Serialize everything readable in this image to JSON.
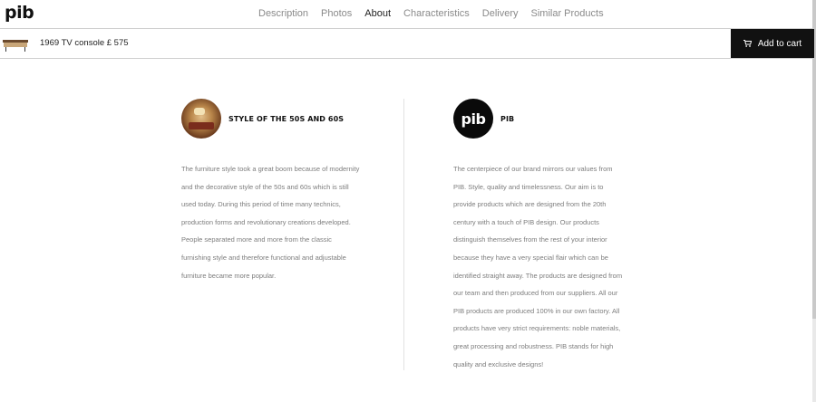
{
  "brand": {
    "logo_text": "pib"
  },
  "nav": {
    "items": [
      {
        "label": "Description",
        "active": false
      },
      {
        "label": "Photos",
        "active": false
      },
      {
        "label": "About",
        "active": true
      },
      {
        "label": "Characteristics",
        "active": false
      },
      {
        "label": "Delivery",
        "active": false
      },
      {
        "label": "Similar Products",
        "active": false
      }
    ]
  },
  "product": {
    "title": "1969 TV console £ 575",
    "cart_label": "Add to cart",
    "cart_icon": "shopping-cart-icon"
  },
  "sections": {
    "left": {
      "heading": "STYLE OF THE 50S AND 60S",
      "image": "room-interior-photo",
      "text": "The furniture style took a great boom because of modernity and the decorative style of the 50s and 60s which is still used today. During this period of time many technics, production forms and revolutionary creations developed. People separated more and more from the classic furnishing style and therefore functional and adjustable furniture became more popular."
    },
    "right": {
      "heading": "PIB",
      "logo_text": "pib",
      "text": "The centerpiece of our brand mirrors our values from PIB. Style, quality and timelessness. Our aim is to provide products which are designed from the 20th century with a touch of PIB design. Our products distinguish themselves from the rest of your interior because they have a very special flair which can be identified straight away. The products are designed from our team and then produced from our suppliers. All our PIB products are produced 100% in our own factory. All products have very strict requirements: noble materials, great processing and robustness. PIB stands for high quality and exclusive designs!"
    }
  },
  "colors": {
    "accent": "#111111",
    "body_text": "#7d7d7d",
    "nav_inactive": "#8a8a8a"
  }
}
